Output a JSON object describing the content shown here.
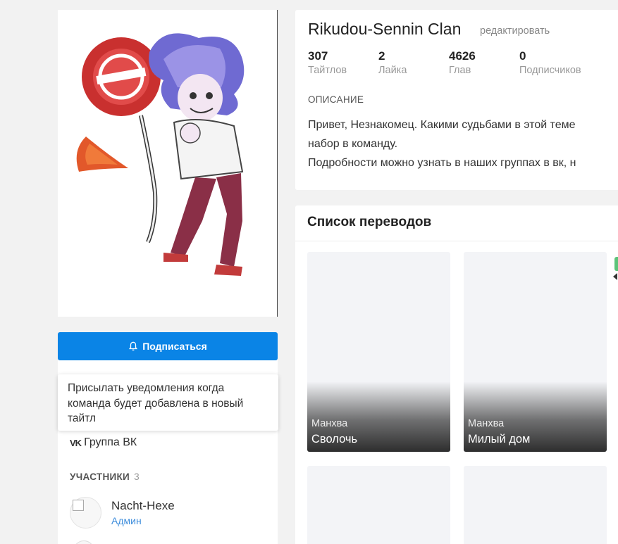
{
  "team": {
    "title": "Rikudou-Sennin Clan",
    "edit_label": "редактировать"
  },
  "stats": [
    {
      "value": "307",
      "label": "Тайтлов"
    },
    {
      "value": "2",
      "label": "Лайка"
    },
    {
      "value": "4626",
      "label": "Глав"
    },
    {
      "value": "0",
      "label": "Подписчиков"
    }
  ],
  "description": {
    "heading": "ОПИСАНИЕ",
    "lines": [
      "Привет, Незнакомец. Какими судьбами в этой теме",
      "набор в команду.",
      "Подробности можно узнать в наших группах в вк, н"
    ]
  },
  "subscribe": {
    "label": "Подписаться",
    "tooltip": "Присылать уведомления когда команда будет добавлена в новый тайтл"
  },
  "links": {
    "vk_label": "Группа ВК"
  },
  "members": {
    "heading": "УЧАСТНИКИ",
    "count": "3",
    "items": [
      {
        "name": "Nacht-Hexe",
        "role": "Админ"
      }
    ]
  },
  "translations": {
    "heading": "Список переводов",
    "items": [
      {
        "type": "Манхва",
        "name": "Сволочь"
      },
      {
        "type": "Манхва",
        "name": "Милый дом"
      }
    ]
  },
  "colors": {
    "accent": "#0a84e6",
    "role_link": "#3f8edc",
    "badge": "#5cc47a"
  }
}
